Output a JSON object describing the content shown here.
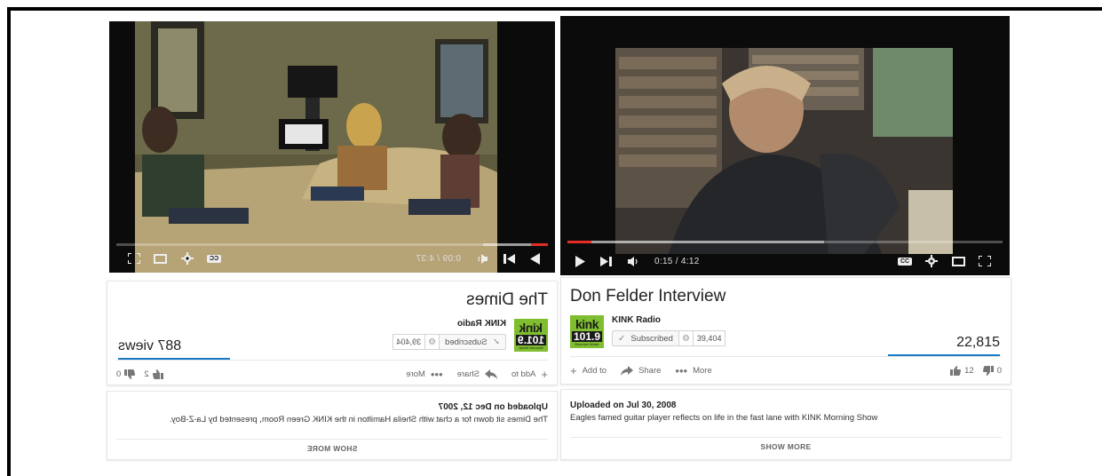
{
  "right_video": {
    "title": "Don Felder Interview",
    "time": "0:15 / 4:12",
    "progress_played": 0.056,
    "progress_loaded": 0.59,
    "channel": {
      "logo_top": "kink",
      "logo_mid": "101.9",
      "logo_bottom": "Discover Music",
      "name": "KINK Radio",
      "subscribe_label": "Subscribed",
      "subscriber_count": "39,404"
    },
    "views": "22,815",
    "actions": {
      "add_to": "Add to",
      "share": "Share",
      "more": "More"
    },
    "likes": "12",
    "dislikes": "0",
    "upload_date": "Uploaded on Jul 30, 2008",
    "description": "Eagles famed guitar player reflects on life in the fast lane with KINK Morning Show",
    "show_more": "SHOW MORE"
  },
  "left_video": {
    "title": "The Dimes",
    "time": "0:09 / 4:37",
    "progress_played": 0.04,
    "progress_loaded": 0.15,
    "channel": {
      "logo_top": "kink",
      "logo_mid": "101.9",
      "logo_bottom": "Discover Music",
      "name": "KINK Radio",
      "subscribe_label": "Subscribed",
      "subscriber_count": "39,404"
    },
    "views": "887 views",
    "actions": {
      "add_to": "Add to",
      "share": "Share",
      "more": "More"
    },
    "likes": "2",
    "dislikes": "0",
    "upload_date": "Uploaded on Dec 12, 2007",
    "description": "The Dimes sit down for a chat with Sheila Hamilton in the KINK Green Room, presented by La-Z-Boy.",
    "show_more": "SHOW MORE"
  },
  "colors": {
    "brand_red": "#e52d27",
    "link_blue": "#167ac6",
    "kink_green": "#7fbe2e"
  }
}
